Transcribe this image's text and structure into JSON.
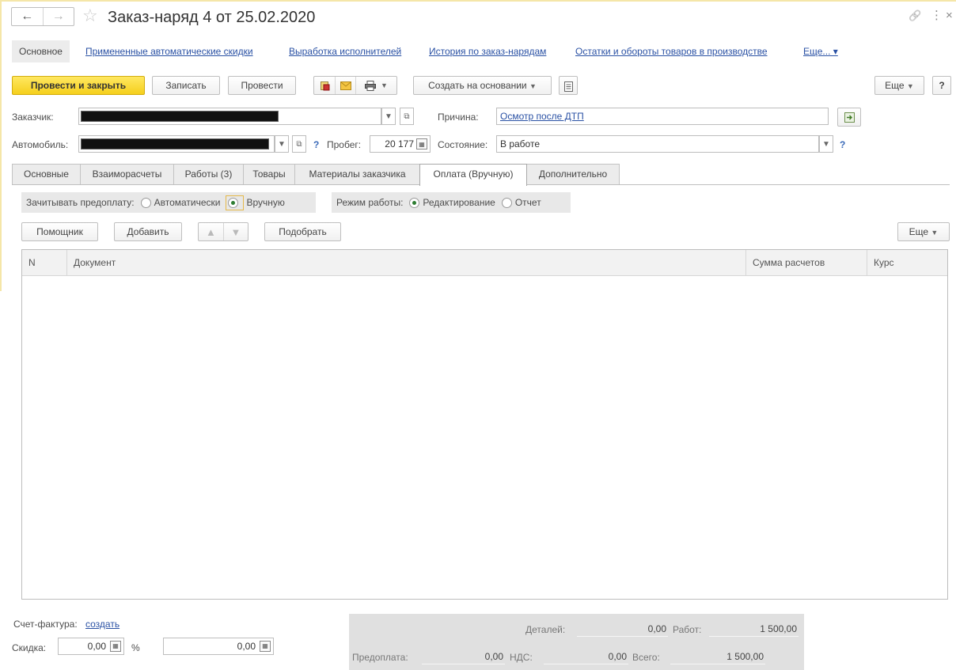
{
  "window": {
    "title": "Заказ-наряд 4 от 25.02.2020",
    "back_glyph": "←",
    "forward_glyph": "→",
    "star_glyph": "☆",
    "link_glyph": "🔗",
    "menu_glyph": "⋮",
    "close_glyph": "×"
  },
  "command_panel": {
    "main": "Основное",
    "links": [
      "Примененные автоматические скидки",
      "Выработка исполнителей",
      "История по заказ-нарядам",
      "Остатки и обороты товаров в производстве",
      "Еще... ▾"
    ]
  },
  "toolbar": {
    "post_close": "Провести и закрыть",
    "save": "Записать",
    "post": "Провести",
    "create_based": "Создать на основании",
    "more": "Еще",
    "help": "?"
  },
  "header": {
    "customer_label": "Заказчик:",
    "reason_label": "Причина:",
    "reason_value": "Осмотр после ДТП",
    "car_label": "Автомобиль:",
    "mileage_label": "Пробег:",
    "mileage_value": "20 177",
    "state_label": "Состояние:",
    "state_value": "В работе",
    "question": "?"
  },
  "tabs": [
    {
      "label": "Основные"
    },
    {
      "label": "Взаиморасчеты"
    },
    {
      "label": "Работы (3)"
    },
    {
      "label": "Товары"
    },
    {
      "label": "Материалы заказчика"
    },
    {
      "label": "Оплата (Вручную)"
    },
    {
      "label": "Дополнительно"
    }
  ],
  "payment_tab": {
    "prepay_label": "Зачитывать предоплату:",
    "prepay_options": [
      "Автоматически",
      "Вручную"
    ],
    "prepay_selected": "Вручную",
    "mode_label": "Режим работы:",
    "mode_options": [
      "Редактирование",
      "Отчет"
    ],
    "mode_selected": "Редактирование",
    "buttons": {
      "assistant": "Помощник",
      "add": "Добавить",
      "pick": "Подобрать",
      "more": "Еще"
    },
    "table": {
      "columns": [
        "N",
        "Документ",
        "Сумма расчетов",
        "Курс"
      ],
      "rows": []
    }
  },
  "footer": {
    "invoice_label": "Счет-фактура:",
    "invoice_link": "создать",
    "discount_label": "Скидка:",
    "discount_value": "0,00",
    "percent": "%",
    "discount_amount": "0,00",
    "totals": {
      "details_label": "Деталей:",
      "details_value": "0,00",
      "works_label": "Работ:",
      "works_value": "1 500,00",
      "prepay_label": "Предоплата:",
      "prepay_value": "0,00",
      "vat_label": "НДС:",
      "vat_value": "0,00",
      "total_label": "Всего:",
      "total_value": "1 500,00"
    }
  }
}
